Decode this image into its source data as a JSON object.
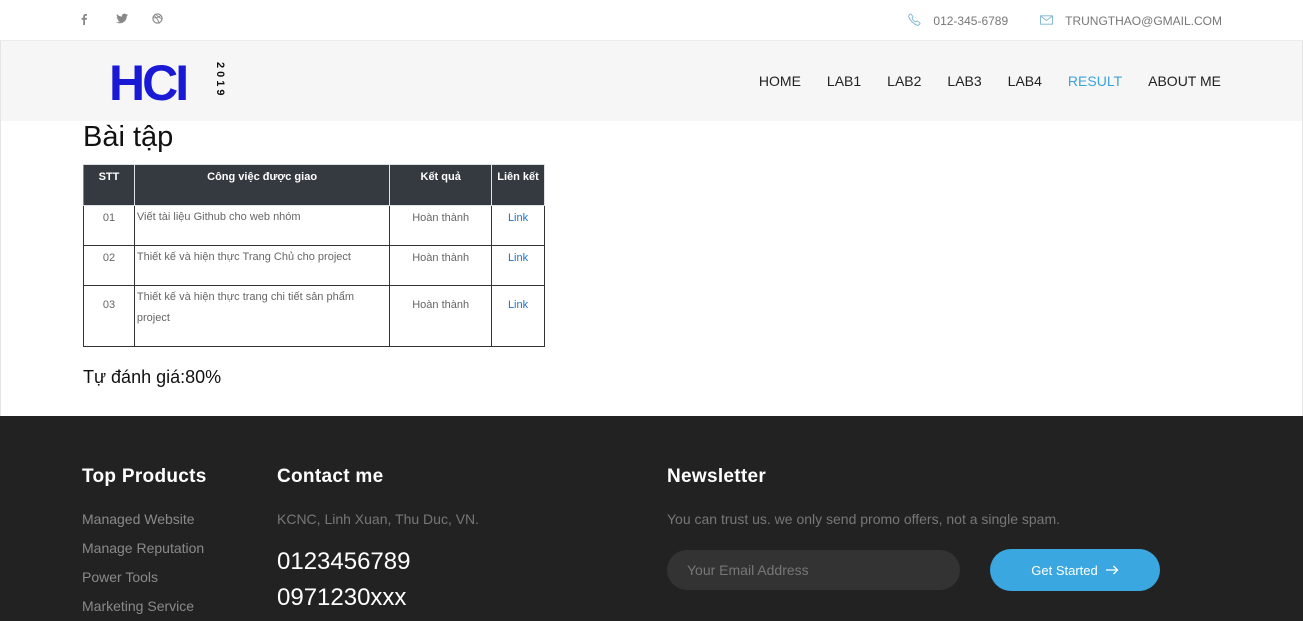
{
  "topbar": {
    "social": [
      {
        "icon": "facebook-icon",
        "glyph": "f"
      },
      {
        "icon": "twitter-icon"
      },
      {
        "icon": "dribbble-icon"
      }
    ],
    "phone": "012-345-6789",
    "email": "TRUNGTHAO@GMAIL.COM"
  },
  "logo": {
    "text": "HCI",
    "year": "2019",
    "color": "#1a1ad6"
  },
  "nav": {
    "items": [
      "HOME",
      "LAB1",
      "LAB2",
      "LAB3",
      "LAB4",
      "RESULT",
      "ABOUT ME"
    ],
    "active": "RESULT",
    "active_color": "#3ca3d9"
  },
  "main": {
    "title": "Bài tập",
    "table": {
      "headers": [
        "STT",
        "Công việc được giao",
        "Kết quả",
        "Liên kết"
      ],
      "rows": [
        {
          "stt": "01",
          "task": "Viết tài liệu Github cho web nhóm",
          "result": "Hoàn thành",
          "link": "Link"
        },
        {
          "stt": "02",
          "task": "Thiết kế và hiện thực Trang Chủ cho project",
          "result": "Hoàn thành",
          "link": "Link"
        },
        {
          "stt": "03",
          "task": "Thiết kế và hiện thực trang chi tiết sản phẩm project",
          "result": "Hoàn thành",
          "link": "Link"
        }
      ]
    },
    "self_eval": "Tự đánh giá:80%"
  },
  "footer": {
    "products": {
      "title": "Top Products",
      "items": [
        "Managed Website",
        "Manage Reputation",
        "Power Tools",
        "Marketing Service"
      ]
    },
    "contact": {
      "title": "Contact me",
      "address": "KCNC, Linh Xuan, Thu Duc, VN.",
      "phones": [
        "0123456789",
        "0971230xxx"
      ]
    },
    "newsletter": {
      "title": "Newsletter",
      "desc": "You can trust us. we only send promo offers, not a single spam.",
      "placeholder": "Your Email Address",
      "button": "Get Started",
      "button_color": "#3aa7e0"
    }
  }
}
